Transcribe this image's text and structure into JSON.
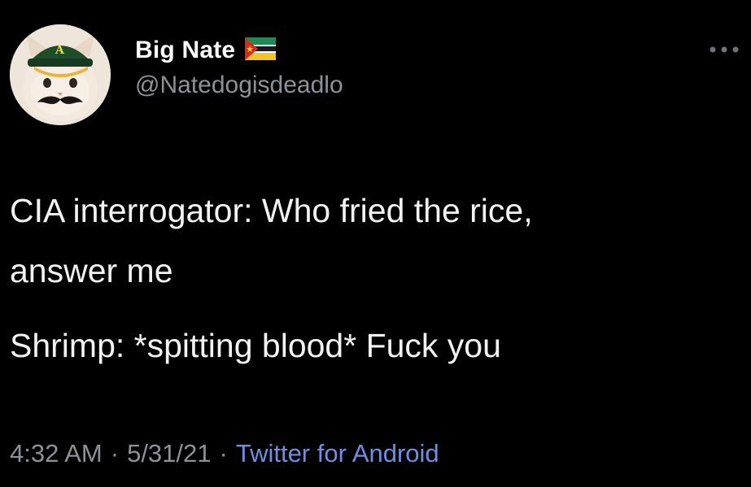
{
  "author": {
    "display_name": "Big Nate",
    "handle": "@Natedogisdeadlo",
    "avatar_icon": "cat-with-cap-and-mustache",
    "flag_icon": "mozambique-flag-emoji"
  },
  "tweet": {
    "lines_para1": [
      "CIA interrogator: Who fried the rice,",
      "answer me"
    ],
    "line_para2": "Shrimp: *spitting blood* Fuck you"
  },
  "meta": {
    "time": "4:32 AM",
    "separator": "·",
    "date": "5/31/21",
    "source": "Twitter for Android"
  },
  "colors": {
    "background": "#000000",
    "text": "#f2f2f2",
    "secondary": "#8b9299",
    "link": "#6f8fe0"
  },
  "icons": {
    "more": "more-horizontal-icon"
  }
}
